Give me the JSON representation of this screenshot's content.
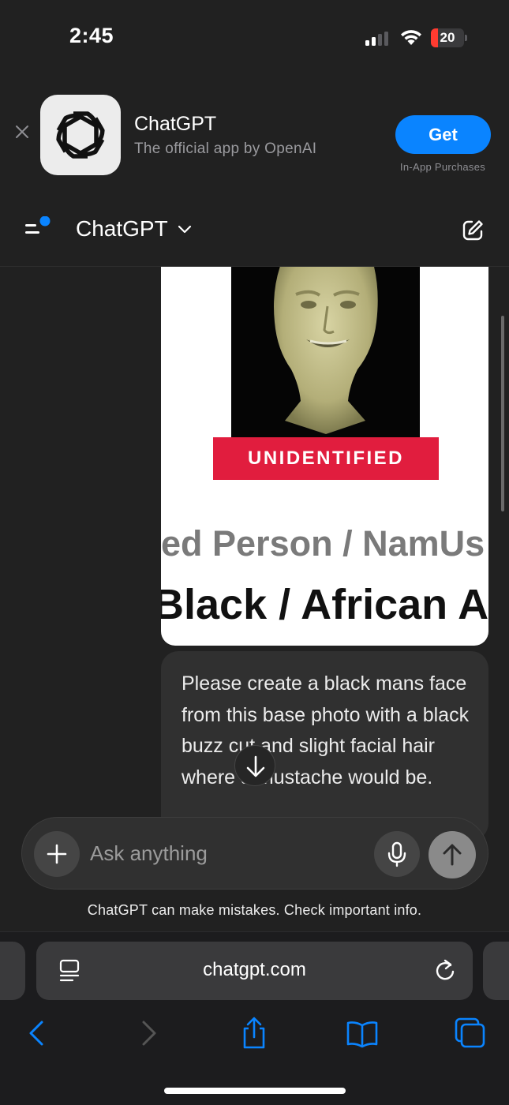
{
  "status_bar": {
    "time": "2:45",
    "battery_level": "20",
    "battery_color": "#ff3b30"
  },
  "app_banner": {
    "app_name": "ChatGPT",
    "subtitle": "The official app by OpenAI",
    "get_label": "Get",
    "purchase_note": "In-App Purchases",
    "accent_color": "#0a84ff"
  },
  "header": {
    "title": "ChatGPT"
  },
  "chat": {
    "attachment": {
      "banner_text": "UNIDENTIFIED",
      "line1": "ed Person / NamUs",
      "line2": "Black / African Am",
      "banner_color": "#e11d3e"
    },
    "message": "Please create a black mans face from this base photo with a black buzz cut and slight facial hair where a mustache would be."
  },
  "composer": {
    "placeholder": "Ask anything",
    "disclaimer": "ChatGPT can make mistakes. Check important info."
  },
  "browser": {
    "url": "chatgpt.com"
  },
  "icons": [
    "close-icon",
    "openai-logo-icon",
    "menu-icon",
    "chevron-down-icon",
    "new-chat-icon",
    "arrow-down-icon",
    "plus-icon",
    "mic-icon",
    "arrow-up-icon",
    "reader-icon",
    "reload-icon",
    "back-icon",
    "forward-icon",
    "share-icon",
    "bookmarks-icon",
    "tabs-icon",
    "signal-icon",
    "wifi-icon",
    "battery-icon"
  ]
}
